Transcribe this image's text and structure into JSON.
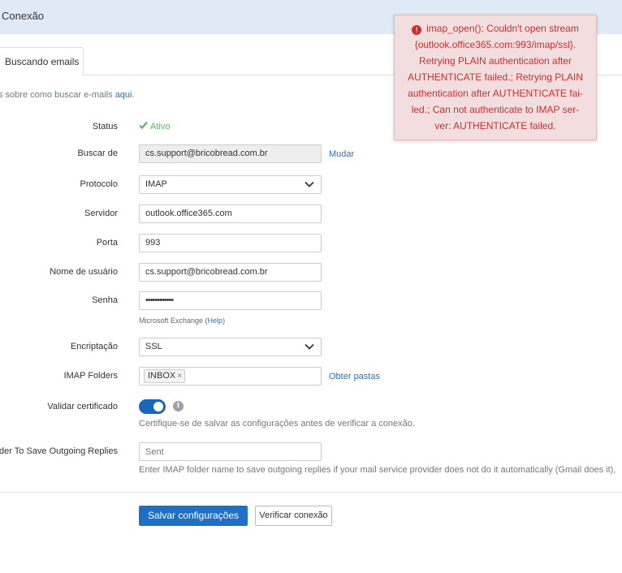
{
  "header": {
    "title": "Conexão"
  },
  "tabs": [
    {
      "label": "Buscando emails"
    }
  ],
  "help": {
    "text": "s sobre como buscar e-mails ",
    "link": "aqui",
    "end": "."
  },
  "form": {
    "status": {
      "label": "Status",
      "value": "Ativo"
    },
    "fetch_from": {
      "label": "Buscar de",
      "value": "cs.support@bricobread.com.br",
      "action": "Mudar"
    },
    "protocol": {
      "label": "Protocolo",
      "value": "IMAP"
    },
    "server": {
      "label": "Servidor",
      "value": "outlook.office365.com"
    },
    "port": {
      "label": "Porta",
      "value": "993"
    },
    "username": {
      "label": "Nome de usuário",
      "value": "cs.support@bricobread.com.br"
    },
    "password": {
      "label": "Senha",
      "value": "••••••••••••",
      "note": "Microsoft Exchange (",
      "note_link": "Help",
      "note_end": ")"
    },
    "encryption": {
      "label": "Encriptação",
      "value": "SSL"
    },
    "imap_folders": {
      "label": "IMAP Folders",
      "tags": [
        "INBOX"
      ],
      "action": "Obter pastas"
    },
    "validate_cert": {
      "label": "Validar certificado",
      "enabled": true,
      "note": "Certifique-se de salvar as configurações antes de verificar a conexão."
    },
    "outgoing_folder": {
      "label": "der To Save Outgoing Replies",
      "placeholder": "Sent",
      "note": "Enter IMAP folder name to save outgoing replies if your mail service provider does not do it automatically (Gmail does it),"
    }
  },
  "buttons": {
    "save": "Salvar configurações",
    "verify": "Verificar conexão"
  },
  "alert": {
    "lines": [
      "imap_open(): Couldn't open stream",
      "{outlook.office365.com:993/imap/ssl}.",
      "Retrying PLAIN authentication after",
      "AUTHENTICATE failed.; Retrying PLAIN",
      "authentication after AUTHENTICATE fai-",
      "led.; Can not authenticate to IMAP ser-",
      "ver: AUTHENTICATE failed."
    ]
  },
  "colors": {
    "header_bg": "#dfeaf6",
    "primary": "#1f6fc7",
    "link": "#2f6fb7",
    "success": "#5cb85c",
    "error": "#c9302c",
    "error_bg": "#f2dede"
  }
}
